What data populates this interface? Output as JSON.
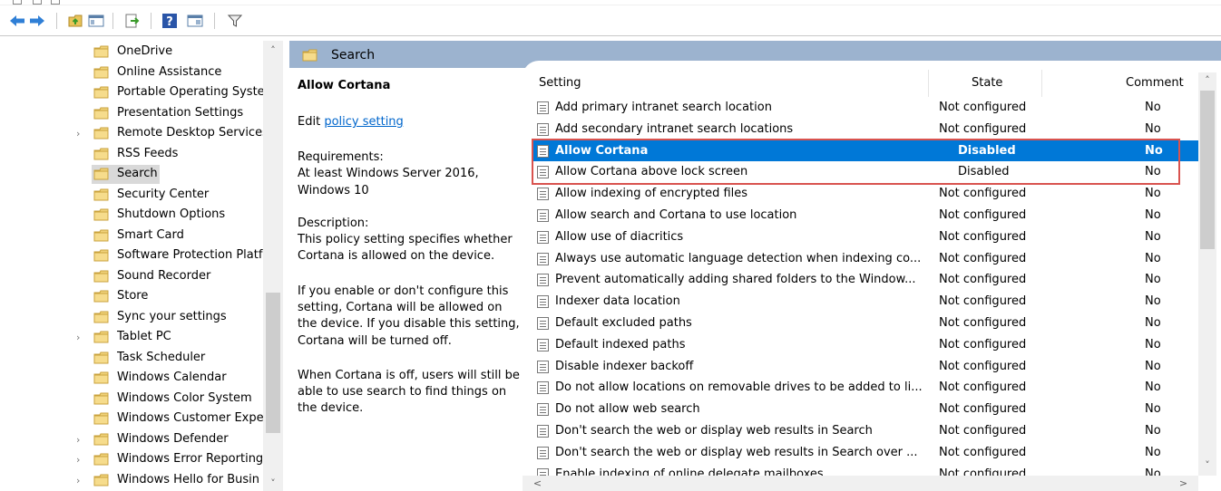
{
  "tree": {
    "items": [
      {
        "label": "OneDrive",
        "expandable": false
      },
      {
        "label": "Online Assistance",
        "expandable": false
      },
      {
        "label": "Portable Operating Syste",
        "expandable": false
      },
      {
        "label": "Presentation Settings",
        "expandable": false
      },
      {
        "label": "Remote Desktop Services",
        "expandable": true
      },
      {
        "label": "RSS Feeds",
        "expandable": false
      },
      {
        "label": "Search",
        "expandable": false,
        "selected": true
      },
      {
        "label": "Security Center",
        "expandable": false
      },
      {
        "label": "Shutdown Options",
        "expandable": false
      },
      {
        "label": "Smart Card",
        "expandable": false
      },
      {
        "label": "Software Protection Platf",
        "expandable": false
      },
      {
        "label": "Sound Recorder",
        "expandable": false
      },
      {
        "label": "Store",
        "expandable": false
      },
      {
        "label": "Sync your settings",
        "expandable": false
      },
      {
        "label": "Tablet PC",
        "expandable": true
      },
      {
        "label": "Task Scheduler",
        "expandable": false
      },
      {
        "label": "Windows Calendar",
        "expandable": false
      },
      {
        "label": "Windows Color System",
        "expandable": false
      },
      {
        "label": "Windows Customer Expe",
        "expandable": false
      },
      {
        "label": "Windows Defender",
        "expandable": true
      },
      {
        "label": "Windows Error Reporting",
        "expandable": true
      },
      {
        "label": "Windows Hello for Busin",
        "expandable": true
      }
    ]
  },
  "panel": {
    "title": "Search"
  },
  "description": {
    "policy_name": "Allow Cortana",
    "edit_prefix": "Edit",
    "edit_link": "policy setting",
    "requirements_label": "Requirements:",
    "requirements_line1": "At least Windows Server 2016,",
    "requirements_line2": "Windows 10",
    "description_label": "Description:",
    "desc_lines": [
      "This policy setting specifies whether",
      "Cortana is allowed on the device."
    ],
    "enable_lines": [
      "If you enable or don't configure this",
      "setting, Cortana will be allowed on",
      "the device. If you disable this setting,",
      "Cortana will be turned off."
    ],
    "off_lines": [
      "When Cortana is off, users will still be",
      "able to use search to find things on",
      "the device."
    ]
  },
  "columns": {
    "setting": "Setting",
    "state": "State",
    "comment": "Comment"
  },
  "rows": [
    {
      "setting": "Add primary intranet search location",
      "state": "Not configured",
      "comment": "No"
    },
    {
      "setting": "Add secondary intranet search locations",
      "state": "Not configured",
      "comment": "No"
    },
    {
      "setting": "Allow Cortana",
      "state": "Disabled",
      "comment": "No",
      "selected": true
    },
    {
      "setting": "Allow Cortana above lock screen",
      "state": "Disabled",
      "comment": "No"
    },
    {
      "setting": "Allow indexing of encrypted files",
      "state": "Not configured",
      "comment": "No"
    },
    {
      "setting": "Allow search and Cortana to use location",
      "state": "Not configured",
      "comment": "No"
    },
    {
      "setting": "Allow use of diacritics",
      "state": "Not configured",
      "comment": "No"
    },
    {
      "setting": "Always use automatic language detection when indexing co...",
      "state": "Not configured",
      "comment": "No"
    },
    {
      "setting": "Prevent automatically adding shared folders to the Window...",
      "state": "Not configured",
      "comment": "No"
    },
    {
      "setting": "Indexer data location",
      "state": "Not configured",
      "comment": "No"
    },
    {
      "setting": "Default excluded paths",
      "state": "Not configured",
      "comment": "No"
    },
    {
      "setting": "Default indexed paths",
      "state": "Not configured",
      "comment": "No"
    },
    {
      "setting": "Disable indexer backoff",
      "state": "Not configured",
      "comment": "No"
    },
    {
      "setting": "Do not allow locations on removable drives to be added to li...",
      "state": "Not configured",
      "comment": "No"
    },
    {
      "setting": "Do not allow web search",
      "state": "Not configured",
      "comment": "No"
    },
    {
      "setting": "Don't search the web or display web results in Search",
      "state": "Not configured",
      "comment": "No"
    },
    {
      "setting": "Don't search the web or display web results in Search over ...",
      "state": "Not configured",
      "comment": "No"
    },
    {
      "setting": "Enable indexing of online delegate mailboxes",
      "state": "Not configured",
      "comment": "No"
    }
  ],
  "colors": {
    "selection": "#0078d7",
    "header_band": "#9cb3cf",
    "highlight": "#d9534f",
    "link": "#0066cc"
  },
  "toolbar": {
    "icons": [
      "back-icon",
      "forward-icon",
      "up-folder-icon",
      "show-hide-tree-icon",
      "export-list-icon",
      "help-icon",
      "extended-view-icon",
      "filter-icon"
    ]
  }
}
